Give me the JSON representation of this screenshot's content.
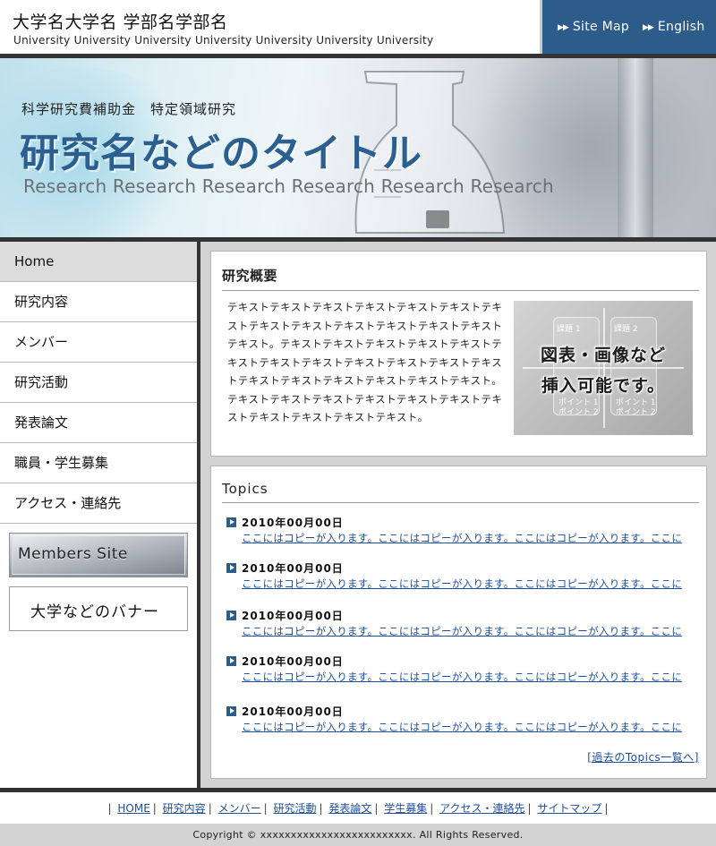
{
  "header": {
    "title": "大学名大学名 学部名学部名",
    "subtitle": "University University University University University University University",
    "links": [
      {
        "label": "Site Map"
      },
      {
        "label": "English"
      }
    ],
    "accent_color": "#2c5c8a"
  },
  "hero": {
    "label": "科学研究費補助金　特定領域研究",
    "title": "研究名などのタイトル",
    "subtitle": "Research Research Research Research Research Research"
  },
  "sidebar": {
    "items": [
      {
        "label": "Home",
        "active": true
      },
      {
        "label": "研究内容"
      },
      {
        "label": "メンバー"
      },
      {
        "label": "研究活動"
      },
      {
        "label": "発表論文"
      },
      {
        "label": "職員・学生募集"
      },
      {
        "label": "アクセス・連絡先"
      }
    ],
    "members_banner": "Members Site",
    "univ_banner": "大学などのバナー"
  },
  "overview": {
    "heading": "研究概要",
    "text": "テキストテキストテキストテキストテキストテキストテキストテキストテキストテキストテキストテキストテキストテキスト。テキストテキストテキストテキストテキストテキストテキストテキストテキストテキストテキストテキストテキストテキストテキストテキストテキストテキスト。テキストテキストテキストテキストテキストテキストテキストテキストテキストテキストテキスト。",
    "figure": {
      "caption_line1": "図表・画像など",
      "caption_line2": "挿入可能です。",
      "box_left_label": "課題 1",
      "box_right_label": "課題 2",
      "box_left_points": [
        "ポイント 1",
        "ポイント 2"
      ],
      "box_right_points": [
        "ポイント 1",
        "ポイント 2"
      ]
    }
  },
  "topics": {
    "heading": "Topics",
    "items": [
      {
        "date": "2010年00月00日",
        "text": "ここにはコピーが入ります。ここにはコピーが入ります。ここにはコピーが入ります。ここに"
      },
      {
        "date": "2010年00月00日",
        "text": "ここにはコピーが入ります。ここにはコピーが入ります。ここにはコピーが入ります。ここに"
      },
      {
        "date": "2010年00月00日",
        "text": "ここにはコピーが入ります。ここにはコピーが入ります。ここにはコピーが入ります。ここに"
      },
      {
        "date": "2010年00月00日",
        "text": "ここにはコピーが入ります。ここにはコピーが入ります。ここにはコピーが入ります。ここに"
      },
      {
        "date": "2010年00月00日",
        "text": "ここにはコピーが入ります。ここにはコピーが入ります。ここにはコピーが入ります。ここに"
      }
    ],
    "past_link": "[過去のTopics一覧へ]"
  },
  "footer": {
    "links": [
      "HOME",
      "研究内容",
      "メンバー",
      "研究活動",
      "発表論文",
      "学生募集",
      "アクセス・連絡先",
      "サイトマップ"
    ],
    "copyright": "Copyright © xxxxxxxxxxxxxxxxxxxxxxxxx. All Rights Reserved."
  }
}
